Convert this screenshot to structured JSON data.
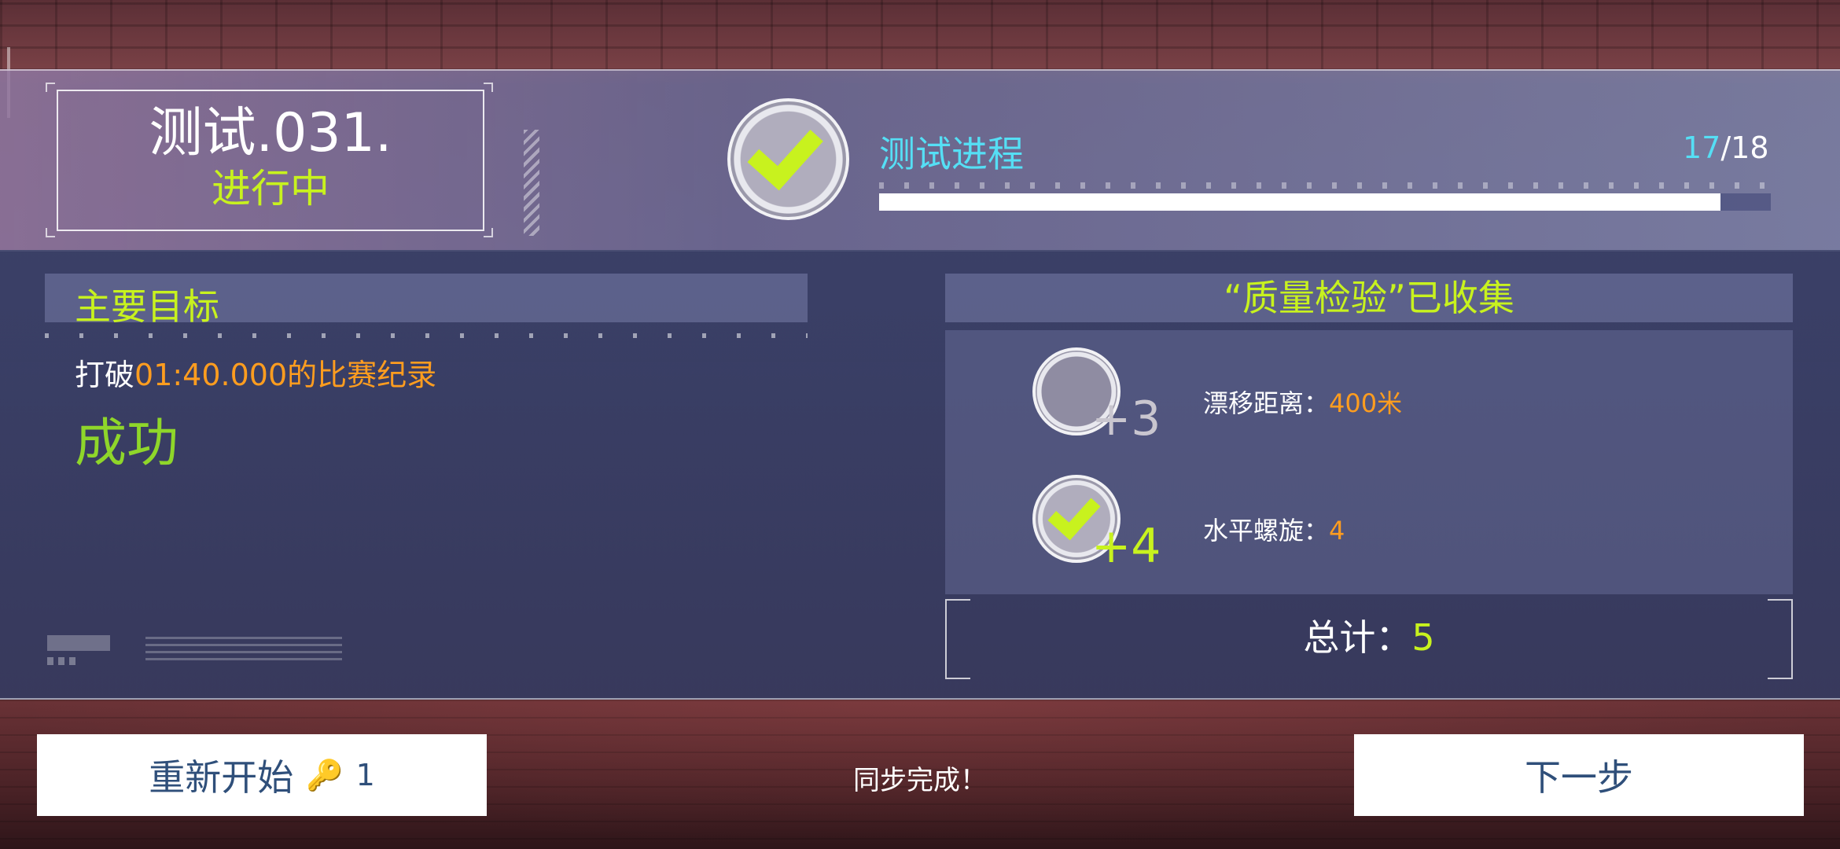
{
  "level": {
    "title": "测试.031.",
    "status": "进行中"
  },
  "progress": {
    "label": "测试进程",
    "current": "17",
    "total_text": "/18",
    "fraction": 0.944
  },
  "objective": {
    "header": "主要目标",
    "text_prefix": "打破",
    "text_highlight": "01:40.000的比赛纪录",
    "result": "成功"
  },
  "collection": {
    "header": "“质量检验”已收集",
    "items": [
      {
        "bonus": "+3",
        "label": "漂移距离：",
        "value": "400米",
        "completed": false
      },
      {
        "bonus": "+4",
        "label": "水平螺旋：",
        "value": "4",
        "completed": true
      }
    ],
    "total_label": "总计：",
    "total_value": "5"
  },
  "footer": {
    "restart_label": "重新开始",
    "key_count": "1",
    "sync_text": "同步完成！",
    "next_label": "下一步"
  },
  "colors": {
    "accent_green": "#c8f21e",
    "accent_cyan": "#55dff5",
    "accent_orange": "#ff9d1f",
    "success_green": "#8fd62a",
    "button_text": "#2f4f7a"
  },
  "icons": {
    "complete": "check-circle-icon",
    "incomplete": "empty-circle-icon",
    "key": "key-icon"
  }
}
